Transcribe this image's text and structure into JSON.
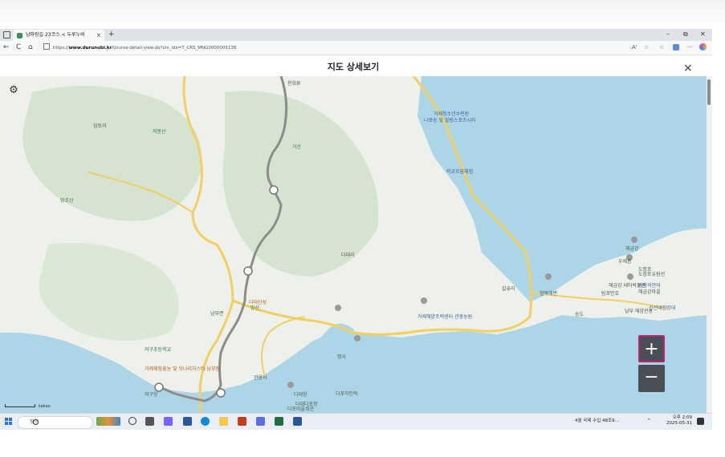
{
  "browser": {
    "tab_title": "남파랑길 23코스 < 두루누비",
    "tab_close": "×",
    "new_tab": "+",
    "window_controls": {
      "minimize": "–",
      "maximize": "⧉",
      "close": "✕"
    },
    "url_prefix": "https://",
    "url_host": "www.durunubi.kr",
    "url_path": "/course-detail-view.do?crs_idx=T_CRS_MNG0000005138",
    "nav": {
      "back": "←",
      "refresh": "C",
      "home": "⌂"
    },
    "toolbar_icons": [
      "read-aloud-icon",
      "favorite-icon",
      "favorites-bar-icon",
      "extensions-icon",
      "more-icon",
      "copilot-icon"
    ]
  },
  "modal": {
    "title": "지도 상세보기",
    "close": "×"
  },
  "map": {
    "settings_icon": "gear-icon",
    "zoom_in": "+",
    "zoom_out": "−",
    "scale_label": "kakao",
    "colors": {
      "land": "#eef0ec",
      "forest": "#cfe0c9",
      "sea": "#acd6e8",
      "road": "#f0d060",
      "route": "#8c8c8c"
    },
    "labels": [
      {
        "text": "천희류",
        "cls": ""
      },
      {
        "text": "거제청소년수련원",
        "cls": "blue"
      },
      {
        "text": "나로송 및 힐링스포츠시티",
        "cls": "blue"
      },
      {
        "text": "임토리",
        "cls": ""
      },
      {
        "text": "거산",
        "cls": "green"
      },
      {
        "text": "저봉산",
        "cls": "green"
      },
      {
        "text": "학교모꿈체험",
        "cls": "blue"
      },
      {
        "text": "망조산",
        "cls": "green"
      },
      {
        "text": "다대리",
        "cls": ""
      },
      {
        "text": "갈곶리",
        "cls": ""
      },
      {
        "text": "망산",
        "cls": "green"
      },
      {
        "text": "남부면",
        "cls": ""
      },
      {
        "text": "다대산성",
        "cls": "orange"
      },
      {
        "text": "거제해양조력센터 관광농원",
        "cls": "blue"
      },
      {
        "text": "저구초등학교",
        "cls": "green"
      },
      {
        "text": "거제체험흥농 및 모나리자스타 남부점",
        "cls": "orange"
      },
      {
        "text": "저구항",
        "cls": ""
      },
      {
        "text": "명사",
        "cls": ""
      },
      {
        "text": "다대항",
        "cls": ""
      },
      {
        "text": "관음사",
        "cls": ""
      },
      {
        "text": "다대다포항",
        "cls": ""
      },
      {
        "text": "다포하인락",
        "cls": ""
      },
      {
        "text": "다포마을회관",
        "cls": ""
      },
      {
        "text": "해금강",
        "cls": ""
      },
      {
        "text": "우제봉",
        "cls": ""
      },
      {
        "text": "도장포",
        "cls": ""
      },
      {
        "text": "바람의언덕",
        "cls": "blue"
      },
      {
        "text": "도장포유람선",
        "cls": ""
      },
      {
        "text": "해금강마을",
        "cls": ""
      },
      {
        "text": "신선대전망대",
        "cls": "blue"
      },
      {
        "text": "함목해변",
        "cls": "blue"
      },
      {
        "text": "송도",
        "cls": ""
      },
      {
        "text": "탐포만호",
        "cls": ""
      },
      {
        "text": "남부 해양관광",
        "cls": ""
      },
      {
        "text": "해금강 테마박물관",
        "cls": ""
      }
    ]
  },
  "taskbar": {
    "search_placeholder": "찾기",
    "weather_text": "4월 국제 수입 48조9...",
    "time": "오후 2:09",
    "date": "2025-05-31",
    "tray_chevron": "^"
  }
}
